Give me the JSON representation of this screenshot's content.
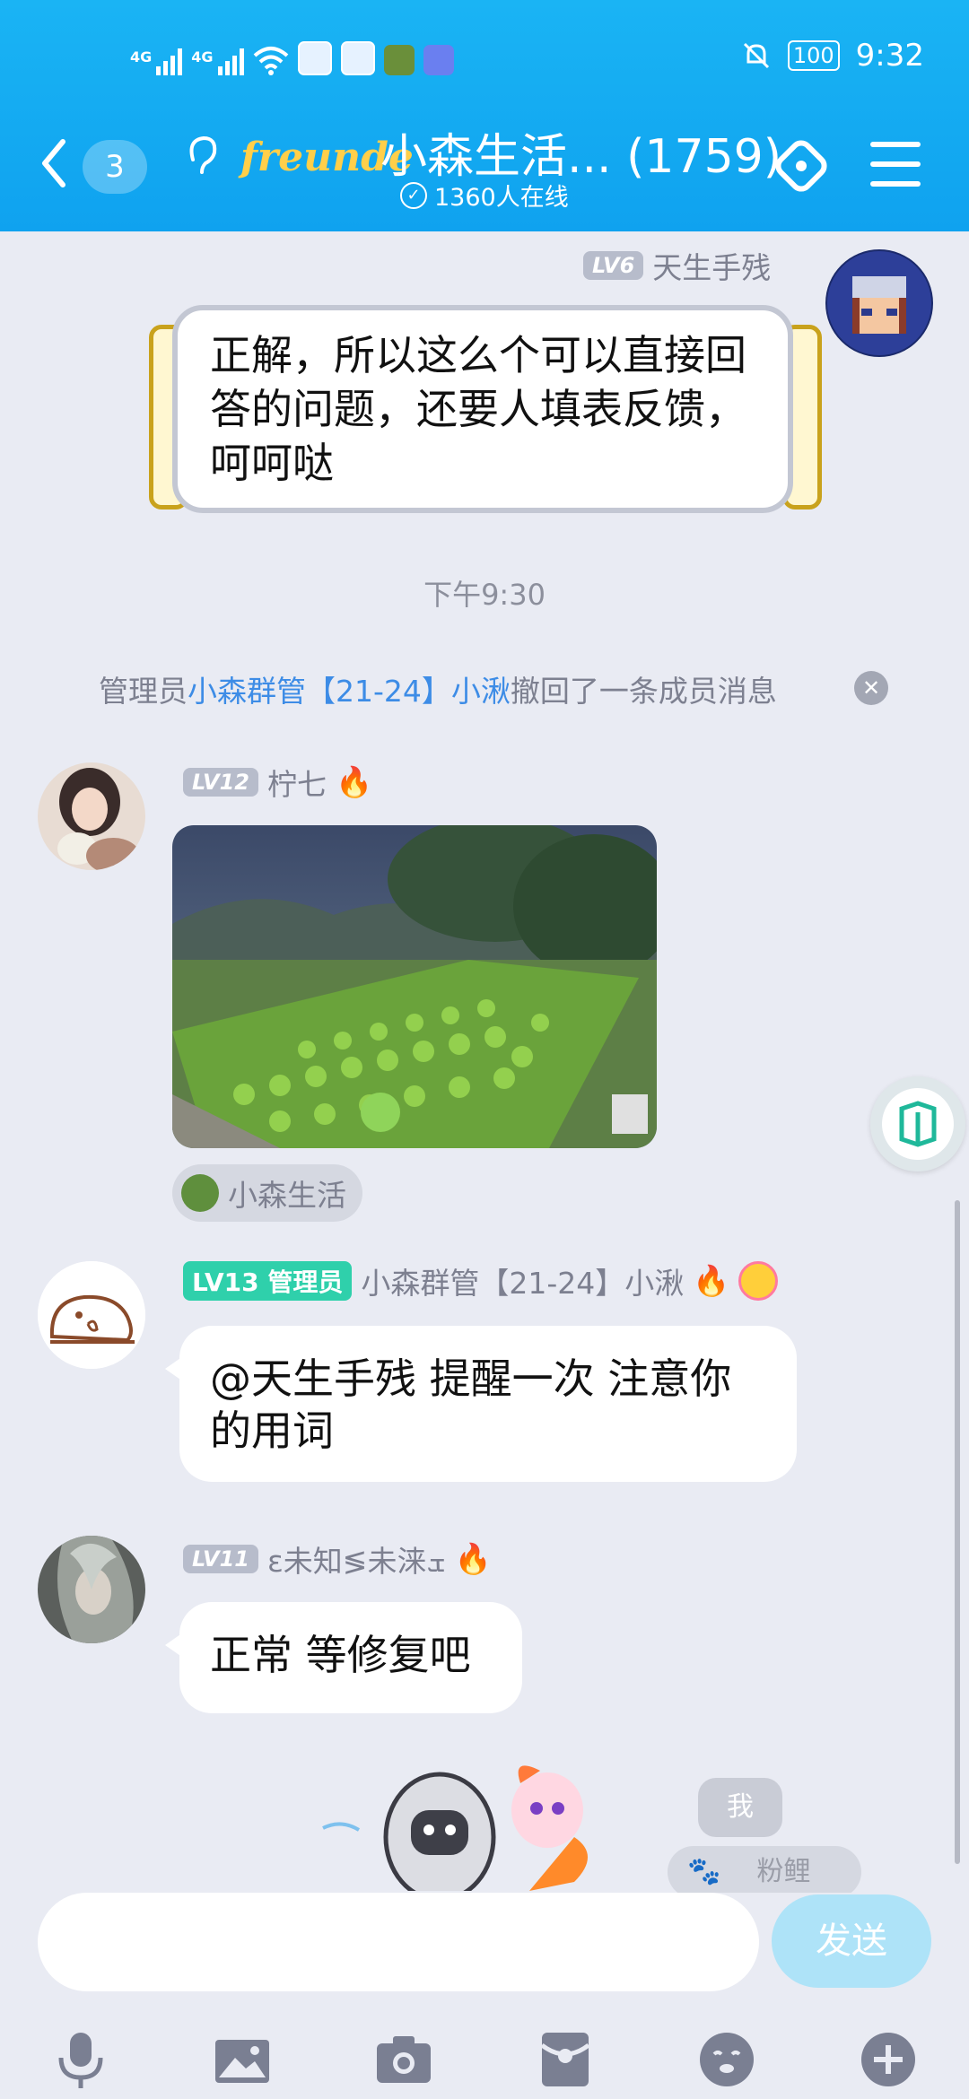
{
  "status_bar": {
    "signal1": "4G",
    "signal2": "4G",
    "battery": "100",
    "time": "9:32"
  },
  "header": {
    "unread_count": "3",
    "brand_text": "freunde",
    "title": "小森生活... (1759)",
    "online": "1360人在线"
  },
  "messages": {
    "top": {
      "level": "LV6",
      "sender": "天生手残",
      "text": "正解，所以这么个可以直接回答的问题，还要人填表反馈，呵呵哒"
    },
    "time_separator": "下午9:30",
    "recall": {
      "prefix": "管理员",
      "admin_name": "小森群管【21-24】小湫",
      "suffix": "撤回了一条成员消息"
    },
    "img_msg": {
      "level": "LV12",
      "sender": "柠七",
      "source": "小森生活"
    },
    "admin_msg": {
      "level": "LV13",
      "role": "管理员",
      "sender": "小森群管【21-24】小湫",
      "text": "@天生手残 提醒一次 注意你的用词"
    },
    "msg3": {
      "level": "LV11",
      "sender": "ɛ未知≶未涞ܫ",
      "text": "正常 等修复吧"
    }
  },
  "stickers": {
    "me_label": "我",
    "fen_label": "粉鲤"
  },
  "input": {
    "placeholder": "",
    "send_label": "发送"
  },
  "colors": {
    "header": "#12a9f1",
    "chat_bg": "#e9ebf3",
    "admin_badge": "#2fd0ab",
    "link": "#3d8ce6"
  }
}
